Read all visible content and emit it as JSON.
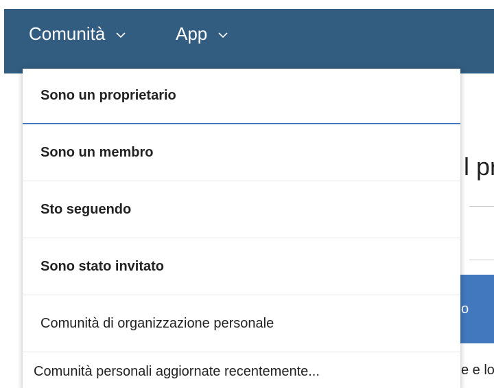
{
  "nav": {
    "items": [
      {
        "label": "Comunità",
        "icon": "chevron-down-icon"
      },
      {
        "label": "App",
        "icon": "chevron-down-icon"
      }
    ],
    "background_color": "#325c80"
  },
  "dropdown": {
    "items": [
      {
        "label": "Sono un proprietario",
        "active": true
      },
      {
        "label": "Sono un membro"
      },
      {
        "label": "Sto seguendo"
      },
      {
        "label": "Sono stato invitato"
      },
      {
        "label": "Comunità di organizzazione personale"
      },
      {
        "label": "Comunità personali aggiornate recentemente..."
      }
    ],
    "active_color": "#4178be"
  },
  "background": {
    "heading_fragment": "l pr",
    "button_fragment": "o",
    "snippet_fragment": "e e lo"
  }
}
